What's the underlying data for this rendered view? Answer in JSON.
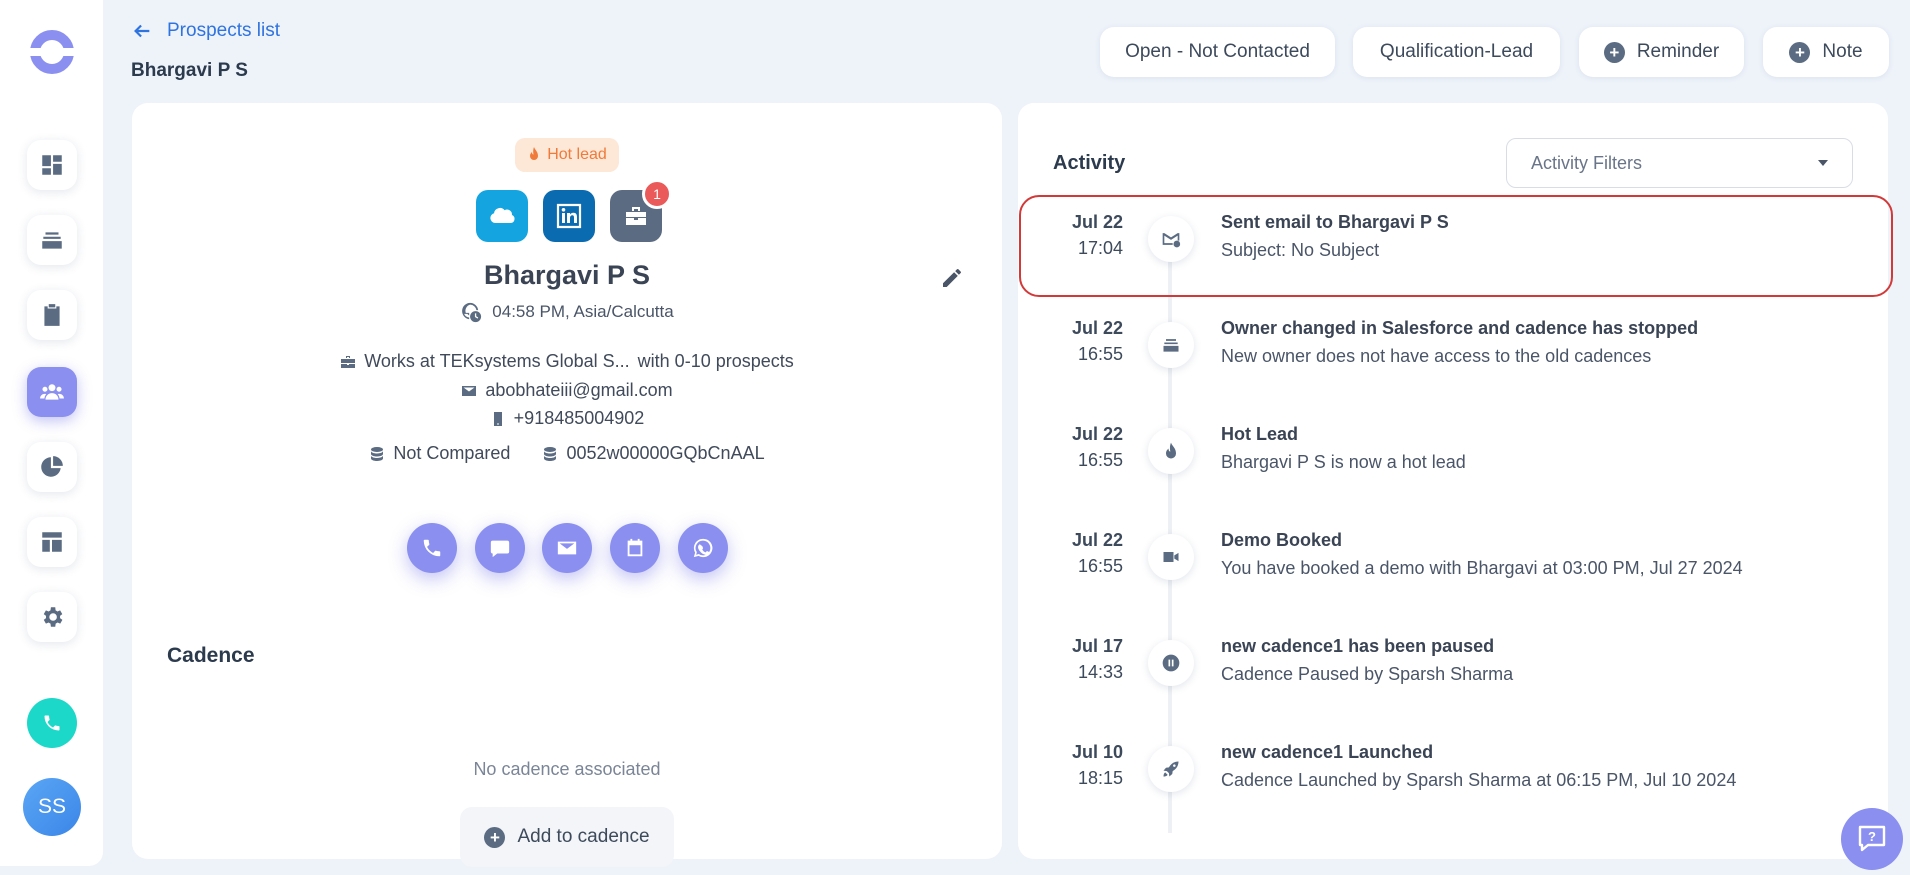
{
  "nav": {
    "back_label": "Prospects list",
    "breadcrumb_name": "Bhargavi P S",
    "user_initials": "SS"
  },
  "top_actions": {
    "status_label": "Open - Not Contacted",
    "stage_label": "Qualification-Lead",
    "reminder_label": "Reminder",
    "note_label": "Note"
  },
  "prospect": {
    "badge": "Hot lead",
    "notification_count": "1",
    "name": "Bhargavi P S",
    "local_time": "04:58 PM, Asia/Calcutta",
    "company": "Works at TEKsystems Global S...",
    "company_size": "with 0-10 prospects",
    "email": "abobhateiii@gmail.com",
    "phone": "+918485004902",
    "compare_status": "Not Compared",
    "crm_id": "0052w00000GQbCnAAL"
  },
  "cadence": {
    "title": "Cadence",
    "empty_text": "No cadence associated",
    "add_label": "Add to cadence"
  },
  "activity": {
    "title": "Activity",
    "filter_placeholder": "Activity Filters",
    "items": [
      {
        "date": "Jul 22",
        "time": "17:04",
        "icon": "email-sent-icon",
        "title": "Sent email to Bhargavi P S",
        "subtitle": "Subject: No Subject"
      },
      {
        "date": "Jul 22",
        "time": "16:55",
        "icon": "owner-change-icon",
        "title": "Owner changed in Salesforce and cadence has stopped",
        "subtitle": "New owner does not have access to the old cadences"
      },
      {
        "date": "Jul 22",
        "time": "16:55",
        "icon": "flame-icon",
        "title": "Hot Lead",
        "subtitle": "Bhargavi P S is now a hot lead"
      },
      {
        "date": "Jul 22",
        "time": "16:55",
        "icon": "video-icon",
        "title": "Demo Booked",
        "subtitle": "You have booked a demo with Bhargavi at 03:00 PM, Jul 27 2024"
      },
      {
        "date": "Jul 17",
        "time": "14:33",
        "icon": "pause-icon",
        "title": "new cadence1 has been paused",
        "subtitle": "Cadence Paused by Sparsh Sharma"
      },
      {
        "date": "Jul 10",
        "time": "18:15",
        "icon": "rocket-icon",
        "title": "new cadence1 Launched",
        "subtitle": "Cadence Launched by Sparsh Sharma at 06:15 PM, Jul 10 2024"
      }
    ]
  },
  "colors": {
    "accent": "#8a8ff0",
    "link": "#2f73e0",
    "hot": "#f07a3a",
    "highlight_border": "#d23a3a",
    "call": "#1cd8c9"
  }
}
